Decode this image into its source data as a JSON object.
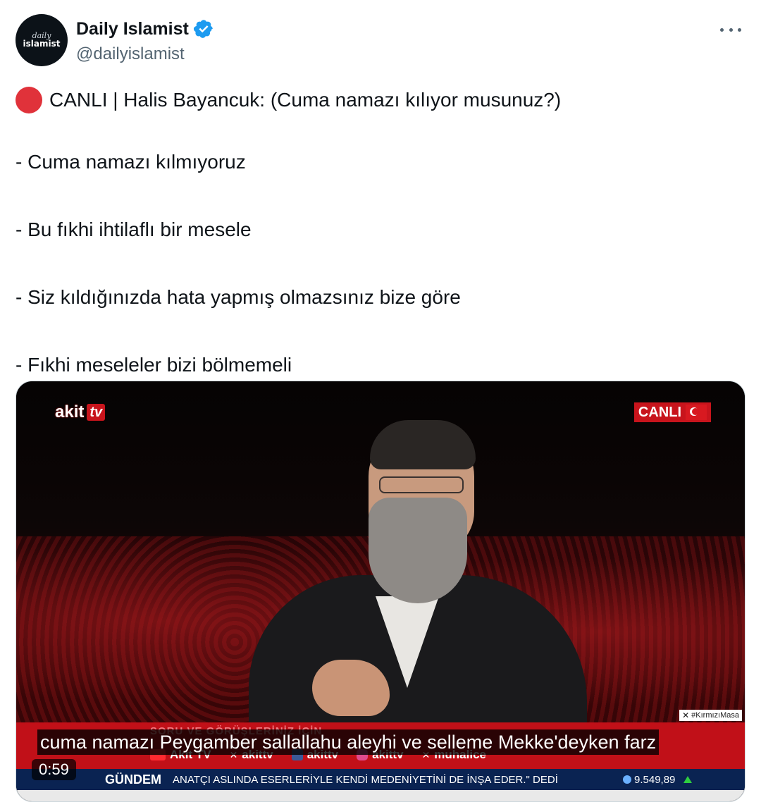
{
  "account": {
    "avatar_line1": "daily",
    "avatar_line2": "islamist",
    "display_name": "Daily Islamist",
    "handle": "@dailyislamist"
  },
  "tweet": {
    "lines": [
      "CANLI | Halis Bayancuk: (Cuma namazı kılıyor musunuz?)",
      "- Cuma namazı kılmıyoruz",
      "- Bu fıkhi ihtilaflı bir mesele",
      "- Siz kıldığınızda hata yapmış olmazsınız bize göre",
      "- Fıkhi meseleler bizi bölmemeli"
    ]
  },
  "video": {
    "logo_text": "akit",
    "logo_tv": "tv",
    "live_label": "CANLI",
    "hashtag": "#KırmızıMasa",
    "red_bar_text": "SORU VE GÖRÜŞLERİNİZ İÇİN",
    "social": [
      "Akit TV",
      "akittv",
      "akittv",
      "akittv",
      "muhalice"
    ],
    "subtitle": "cuma namazı Peygamber sallallahu aleyhi ve selleme Mekke'deyken farz",
    "ticker_label": "GÜNDEM",
    "ticker_text": "ANATÇI ASLINDA ESERLERİYLE KENDİ MEDENİYETİNİ DE İNŞA EDER.\" DEDİ",
    "index_value": "9.549,89",
    "duration": "0:59"
  },
  "colors": {
    "verified": "#1d9bf0",
    "live_dot": "#e0323a",
    "tv_red": "#c11018",
    "ticker_blue": "#0a2352"
  }
}
